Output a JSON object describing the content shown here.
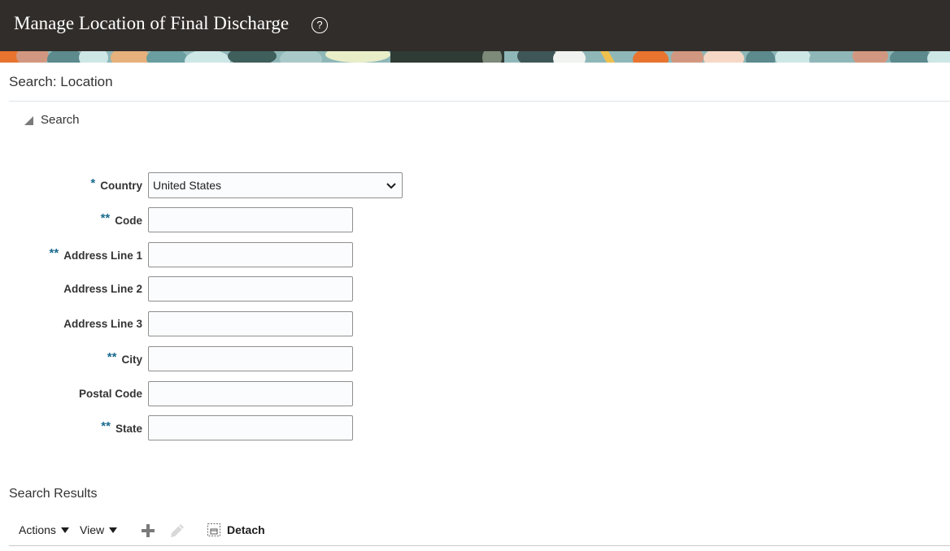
{
  "header": {
    "title": "Manage Location of Final Discharge",
    "help_glyph": "?",
    "help_icon": "help-circle-icon",
    "background": "#312d2a"
  },
  "search_section": {
    "title": "Search: Location",
    "toggle_label": "Search",
    "fields": [
      {
        "label": "Country",
        "required": "*",
        "type": "select",
        "value": "United States"
      },
      {
        "label": "Code",
        "required": "**",
        "type": "text",
        "value": ""
      },
      {
        "label": "Address Line 1",
        "required": "**",
        "type": "text",
        "value": ""
      },
      {
        "label": "Address Line 2",
        "required": "",
        "type": "text",
        "value": ""
      },
      {
        "label": "Address Line 3",
        "required": "",
        "type": "text",
        "value": ""
      },
      {
        "label": "City",
        "required": "**",
        "type": "text",
        "value": ""
      },
      {
        "label": "Postal Code",
        "required": "",
        "type": "text",
        "value": ""
      },
      {
        "label": "State",
        "required": "**",
        "type": "text",
        "value": ""
      }
    ]
  },
  "results": {
    "title": "Search Results",
    "toolbar": {
      "actions_label": "Actions",
      "view_label": "View",
      "add_icon": "plus-icon",
      "edit_icon": "pencil-icon",
      "detach_icon": "detach-icon",
      "detach_label": "Detach"
    }
  },
  "colors": {
    "required_marker": "#1a6b8e",
    "field_border": "#8f8f8f"
  }
}
